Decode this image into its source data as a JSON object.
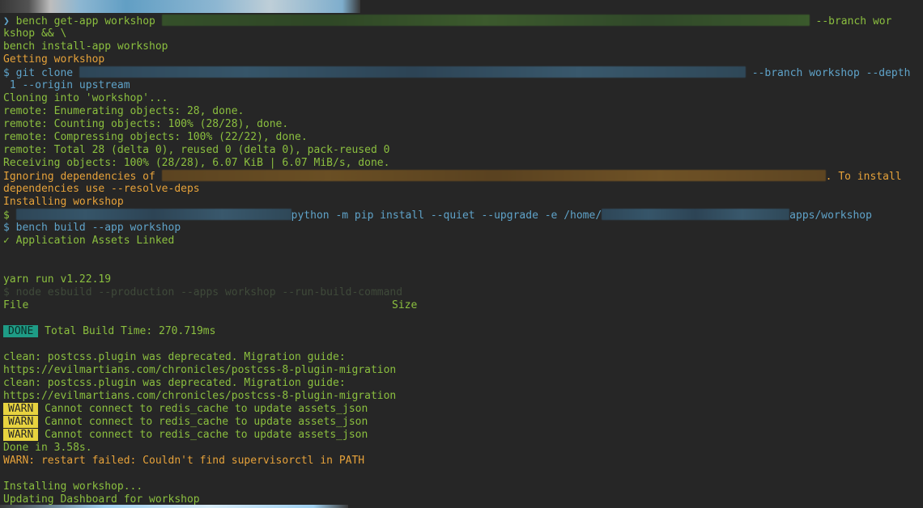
{
  "terminal": {
    "colors": {
      "background": "#262626",
      "green": "#8bbf3f",
      "orange": "#e6a23a",
      "blue": "#5fa3c9",
      "done_badge": "#1e9c86",
      "warn_badge": "#e8d33f"
    },
    "cmd1": {
      "prompt": "❯",
      "text": " bench get-app workshop ",
      "tail": " --branch wor",
      "cont1": "kshop && \\",
      "cont2": "bench install-app workshop"
    },
    "getting": "Getting workshop",
    "clone": {
      "prefix": "$ git clone ",
      "tail": " --branch workshop --depth",
      "cont": " 1 --origin upstream"
    },
    "cloning_into": "Cloning into 'workshop'...",
    "remote_lines": [
      "remote: Enumerating objects: 28, done.",
      "remote: Counting objects: 100% (28/28), done.",
      "remote: Compressing objects: 100% (22/22), done.",
      "remote: Total 28 (delta 0), reused 0 (delta 0), pack-reused 0",
      "Receiving objects: 100% (28/28), 6.07 KiB | 6.07 MiB/s, done."
    ],
    "ignoring": {
      "prefix": "Ignoring dependencies of ",
      "tail": ". To install",
      "cont": "dependencies use --resolve-deps"
    },
    "installing": "Installing workshop",
    "pip": {
      "prefix": "$ ",
      "mid": "python -m pip install --quiet --upgrade -e /home/",
      "tail": "apps/workshop"
    },
    "bench_build": "$ bench build --app workshop",
    "assets_linked": "✓ Application Assets Linked",
    "yarn": "yarn run v1.22.19",
    "esbuild": "$ node esbuild --production --apps workshop --run-build-command",
    "table": {
      "file": "File",
      "size": "Size"
    },
    "done": {
      "badge": "DONE",
      "text": "Total Build Time: 270.719ms"
    },
    "clean_lines": [
      "clean: postcss.plugin was deprecated. Migration guide:",
      "https://evilmartians.com/chronicles/postcss-8-plugin-migration",
      "clean: postcss.plugin was deprecated. Migration guide:",
      "https://evilmartians.com/chronicles/postcss-8-plugin-migration"
    ],
    "warns": {
      "badge": "WARN",
      "items": [
        "Cannot connect to redis_cache to update assets_json",
        "Cannot connect to redis_cache to update assets_json",
        "Cannot connect to redis_cache to update assets_json"
      ]
    },
    "done_in": "Done in 3.58s.",
    "restart_failed": "WARN: restart failed: Couldn't find supervisorctl in PATH",
    "installing2": "Installing workshop...",
    "updating": "Updating Dashboard for workshop"
  }
}
